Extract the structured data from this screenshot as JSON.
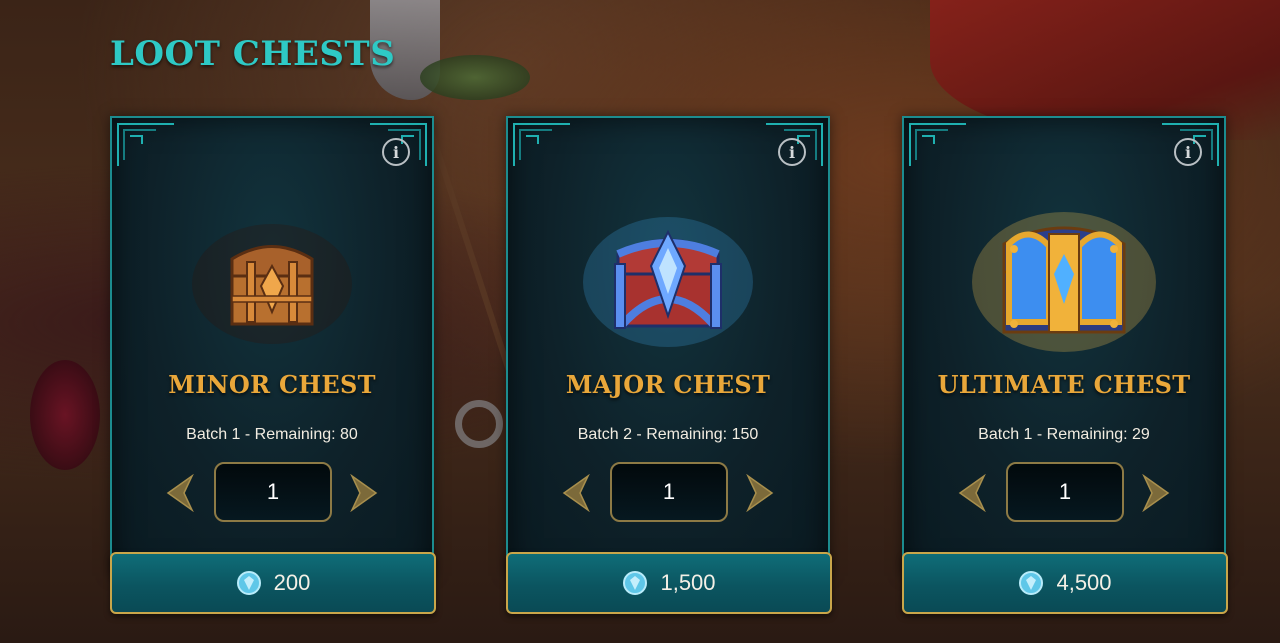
{
  "page": {
    "title": "LOOT CHESTS"
  },
  "colors": {
    "title": "#2ec9c5",
    "chest_name": "#e9a73a",
    "card_border": "#1c8c8f",
    "price_border": "#c9a64a",
    "price_fill": "#0b5560",
    "arrow_gold": "#8d7a45"
  },
  "chests": [
    {
      "name": "MINOR CHEST",
      "batch_text": "Batch 1 - Remaining: 80",
      "quantity": "1",
      "price": "200",
      "icon": "minor-chest-icon"
    },
    {
      "name": "MAJOR CHEST",
      "batch_text": "Batch 2 - Remaining: 150",
      "quantity": "1",
      "price": "1,500",
      "icon": "major-chest-icon"
    },
    {
      "name": "ULTIMATE CHEST",
      "batch_text": "Batch 1 - Remaining: 29",
      "quantity": "1",
      "price": "4,500",
      "icon": "ultimate-chest-icon"
    }
  ],
  "icons": {
    "info": "info-icon",
    "decrement": "chevron-left-icon",
    "increment": "chevron-right-icon",
    "currency": "gem-currency-icon"
  }
}
